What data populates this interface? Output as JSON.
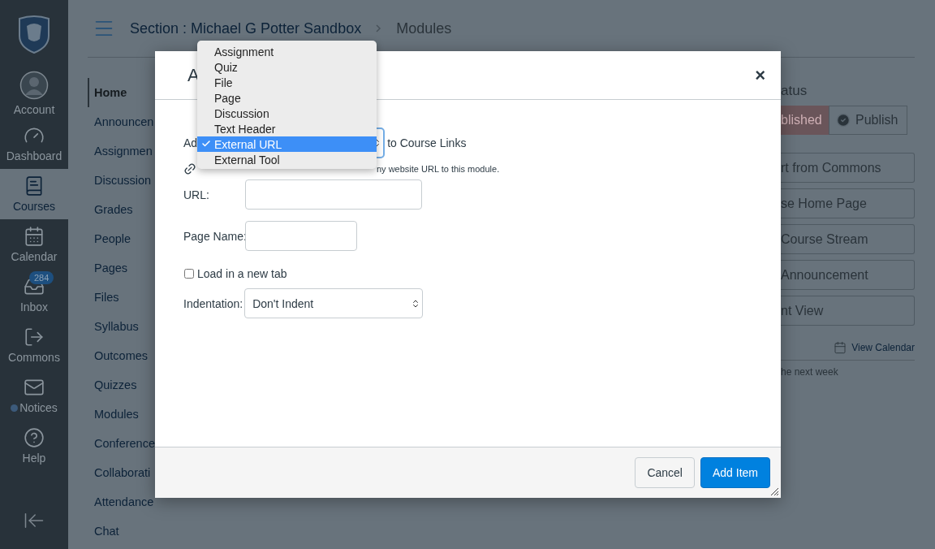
{
  "global_nav": {
    "items": [
      {
        "label": "Account",
        "selected": false
      },
      {
        "label": "Dashboard",
        "selected": false
      },
      {
        "label": "Courses",
        "selected": true
      },
      {
        "label": "Calendar",
        "selected": false
      },
      {
        "label": "Inbox",
        "selected": false,
        "badge": "284"
      },
      {
        "label": "Commons",
        "selected": false
      },
      {
        "label": "Notices",
        "selected": false
      },
      {
        "label": "Help",
        "selected": false
      }
    ]
  },
  "breadcrumb": {
    "course": "Section : Michael G Potter Sandbox",
    "current": "Modules"
  },
  "course_nav": {
    "items": [
      {
        "label": "Home",
        "selected": true
      },
      {
        "label": "Announcen",
        "selected": false
      },
      {
        "label": "Assignmen",
        "selected": false
      },
      {
        "label": "Discussion",
        "selected": false
      },
      {
        "label": "Grades",
        "selected": false
      },
      {
        "label": "People",
        "selected": false
      },
      {
        "label": "Pages",
        "selected": false
      },
      {
        "label": "Files",
        "selected": false
      },
      {
        "label": "Syllabus",
        "selected": false
      },
      {
        "label": "Outcomes",
        "selected": false
      },
      {
        "label": "Quizzes",
        "selected": false
      },
      {
        "label": "Modules",
        "selected": false
      },
      {
        "label": "Conference",
        "selected": false
      },
      {
        "label": "Collaborati",
        "selected": false
      },
      {
        "label": "Attendance",
        "selected": false
      },
      {
        "label": "Chat",
        "selected": false
      }
    ]
  },
  "right_sidebar": {
    "heading": "atus",
    "unpublished": "blished",
    "publish": "Publish",
    "buttons": [
      "rt from Commons",
      "se Home Page",
      "Course Stream",
      "Announcement",
      "nt View"
    ],
    "calendar_link": "View Calendar",
    "note": "he next week"
  },
  "modal": {
    "title": "A",
    "close": "×",
    "add_label": "Ad",
    "add_suffix": "to Course Links",
    "hint": "ny website URL to this module.",
    "fields": [
      {
        "label": "URL:",
        "kind": "wide"
      },
      {
        "label": "Page Name:",
        "kind": "narrow"
      }
    ],
    "checkbox": {
      "label": "Load in a new tab",
      "checked": false
    },
    "indentation": {
      "label": "Indentation:",
      "value": "Don't Indent"
    },
    "buttons": [
      {
        "label": "Cancel",
        "kind": "secondary"
      },
      {
        "label": "Add Item",
        "kind": "primary"
      }
    ]
  },
  "dropdown": {
    "options": [
      {
        "label": "Assignment",
        "selected": false
      },
      {
        "label": "Quiz",
        "selected": false
      },
      {
        "label": "File",
        "selected": false
      },
      {
        "label": "Page",
        "selected": false
      },
      {
        "label": "Discussion",
        "selected": false
      },
      {
        "label": "Text Header",
        "selected": false
      },
      {
        "label": "External URL",
        "selected": true
      },
      {
        "label": "External Tool",
        "selected": false
      }
    ]
  }
}
